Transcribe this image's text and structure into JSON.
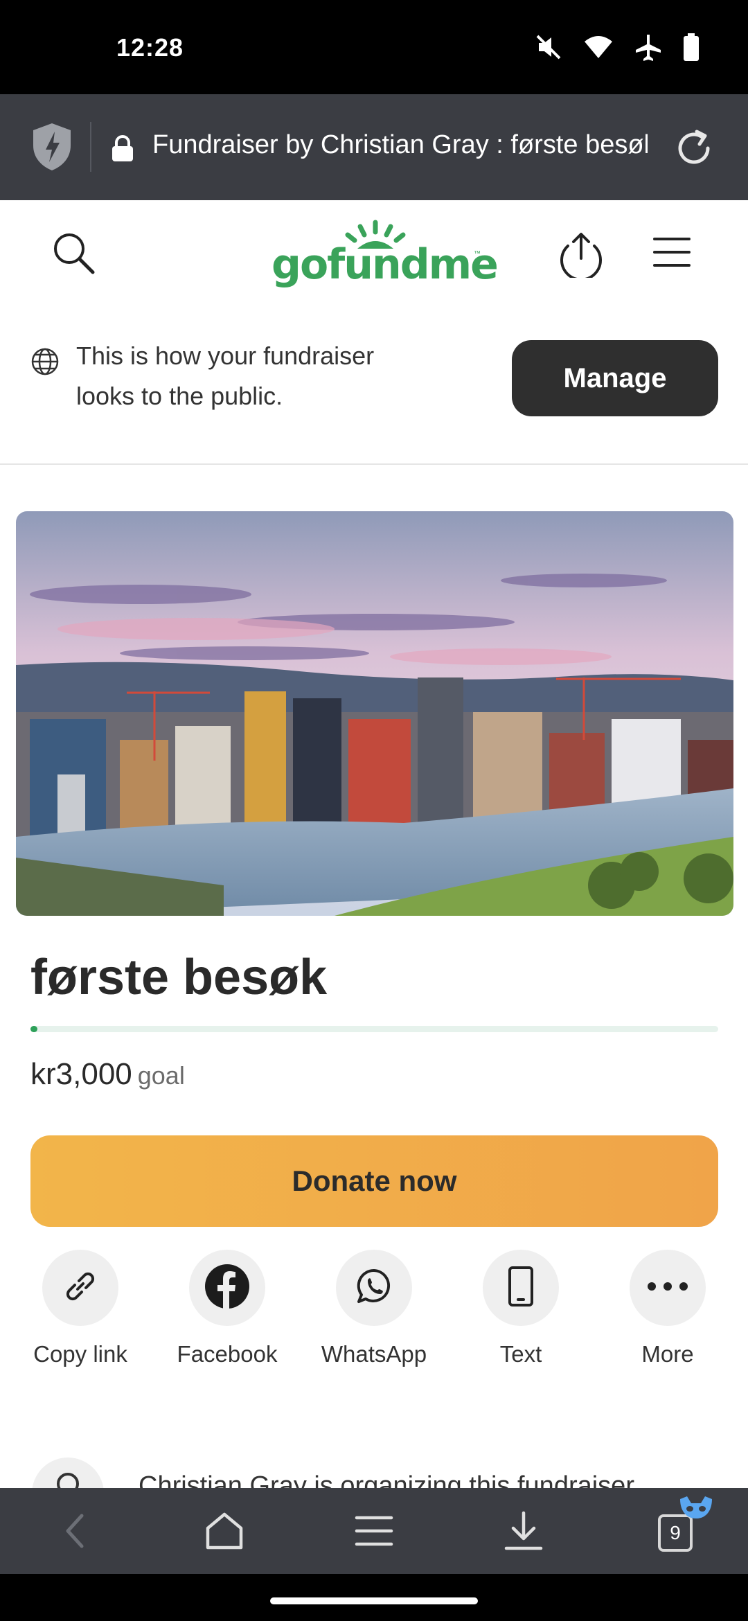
{
  "status_bar": {
    "time": "12:28"
  },
  "browser": {
    "url_text": "Fundraiser by Christian Gray : første besøk"
  },
  "site": {
    "logo_text": "gofundme",
    "logo_tm": "™"
  },
  "notice": {
    "text": "This is how your fundraiser looks to the public.",
    "manage_label": "Manage"
  },
  "fundraiser": {
    "title": "første besøk",
    "goal_amount": "kr3,000",
    "goal_label": "goal",
    "progress_fraction": 0.01,
    "donate_label": "Donate now"
  },
  "share": [
    {
      "label": "Copy link",
      "icon": "link-icon"
    },
    {
      "label": "Facebook",
      "icon": "facebook-icon"
    },
    {
      "label": "WhatsApp",
      "icon": "whatsapp-icon"
    },
    {
      "label": "Text",
      "icon": "phone-icon"
    },
    {
      "label": "More",
      "icon": "more-icon"
    }
  ],
  "organizer": {
    "text": "Christian Gray is organizing this fundraiser."
  },
  "bottom_nav": {
    "tabs_count": "9"
  },
  "colors": {
    "brand_green": "#3aa35a",
    "donate_orange": "#f2b54a",
    "browser_bar": "#3b3d43"
  }
}
